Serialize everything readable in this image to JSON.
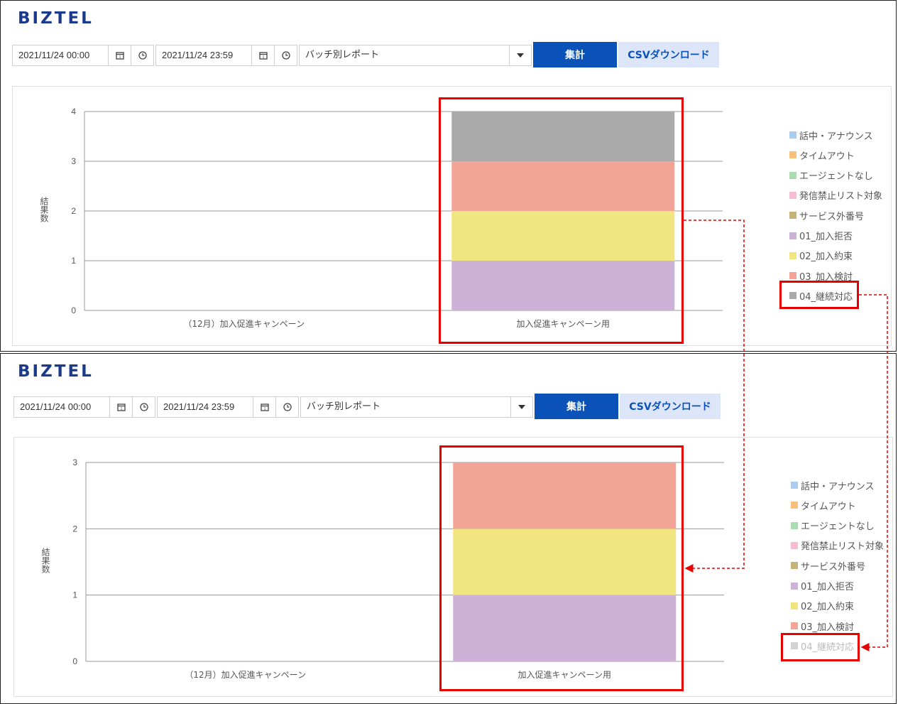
{
  "app": {
    "logo": "BIZTEL"
  },
  "colors": {
    "talk_announce": "#a8cdee",
    "timeout": "#f8c07a",
    "no_agent": "#a9dcb0",
    "blacklist": "#f7bcd3",
    "out_of_service": "#c9b27a",
    "refuse": "#cdb1d6",
    "promise": "#f0e57f",
    "consider": "#f2a497",
    "continue": "#aaaaaa",
    "continue_disabled": "#d3d3d3",
    "primary_button": "#0a52b8",
    "highlight": "#e60000"
  },
  "panels": [
    {
      "toolbar": {
        "start": "2021/11/24 00:00",
        "end": "2021/11/24 23:59",
        "report_type": "バッチ別レポート",
        "aggregate_label": "集計",
        "csv_label": "CSVダウンロード"
      },
      "legend": [
        {
          "label": "話中・アナウンス",
          "color": "#a8cdee",
          "enabled": true
        },
        {
          "label": "タイムアウト",
          "color": "#f8c07a",
          "enabled": true
        },
        {
          "label": "エージェントなし",
          "color": "#a9dcb0",
          "enabled": true
        },
        {
          "label": "発信禁止リスト対象",
          "color": "#f7bcd3",
          "enabled": true
        },
        {
          "label": "サービス外番号",
          "color": "#c9b27a",
          "enabled": true
        },
        {
          "label": "01_加入拒否",
          "color": "#cdb1d6",
          "enabled": true
        },
        {
          "label": "02_加入約束",
          "color": "#f0e57f",
          "enabled": true
        },
        {
          "label": "03_加入検討",
          "color": "#f2a497",
          "enabled": true
        },
        {
          "label": "04_継続対応",
          "color": "#aaaaaa",
          "enabled": true
        }
      ],
      "chart_data": {
        "type": "bar",
        "stacked": true,
        "ylabel": "結果数",
        "ylim": [
          0,
          4
        ],
        "yticks": [
          "0",
          "1",
          "2",
          "3",
          "4"
        ],
        "categories": [
          "（12月）加入促進キャンペーン",
          "加入促進キャンペーン用"
        ],
        "series": [
          {
            "name": "01_加入拒否",
            "values": [
              0,
              1
            ],
            "color": "#cdb1d6"
          },
          {
            "name": "02_加入約束",
            "values": [
              0,
              1
            ],
            "color": "#f0e57f"
          },
          {
            "name": "03_加入検討",
            "values": [
              0,
              1
            ],
            "color": "#f2a497"
          },
          {
            "name": "04_継続対応",
            "values": [
              0,
              1
            ],
            "color": "#aaaaaa"
          }
        ]
      }
    },
    {
      "toolbar": {
        "start": "2021/11/24 00:00",
        "end": "2021/11/24 23:59",
        "report_type": "バッチ別レポート",
        "aggregate_label": "集計",
        "csv_label": "CSVダウンロード"
      },
      "legend": [
        {
          "label": "話中・アナウンス",
          "color": "#a8cdee",
          "enabled": true
        },
        {
          "label": "タイムアウト",
          "color": "#f8c07a",
          "enabled": true
        },
        {
          "label": "エージェントなし",
          "color": "#a9dcb0",
          "enabled": true
        },
        {
          "label": "発信禁止リスト対象",
          "color": "#f7bcd3",
          "enabled": true
        },
        {
          "label": "サービス外番号",
          "color": "#c9b27a",
          "enabled": true
        },
        {
          "label": "01_加入拒否",
          "color": "#cdb1d6",
          "enabled": true
        },
        {
          "label": "02_加入約束",
          "color": "#f0e57f",
          "enabled": true
        },
        {
          "label": "03_加入検討",
          "color": "#f2a497",
          "enabled": true
        },
        {
          "label": "04_継続対応",
          "color": "#d3d3d3",
          "enabled": false
        }
      ],
      "chart_data": {
        "type": "bar",
        "stacked": true,
        "ylabel": "結果数",
        "ylim": [
          0,
          3
        ],
        "yticks": [
          "0",
          "1",
          "2",
          "3"
        ],
        "categories": [
          "（12月）加入促進キャンペーン",
          "加入促進キャンペーン用"
        ],
        "series": [
          {
            "name": "01_加入拒否",
            "values": [
              0,
              1
            ],
            "color": "#cdb1d6"
          },
          {
            "name": "02_加入約束",
            "values": [
              0,
              1
            ],
            "color": "#f0e57f"
          },
          {
            "name": "03_加入検討",
            "values": [
              0,
              1
            ],
            "color": "#f2a497"
          }
        ]
      }
    }
  ]
}
